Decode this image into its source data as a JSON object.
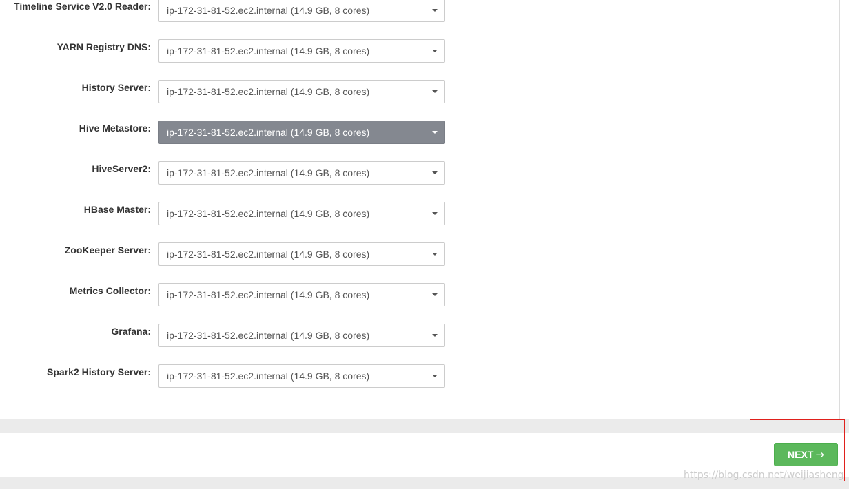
{
  "form": {
    "rows": [
      {
        "label": "Timeline Service V2.0 Reader:",
        "value": "ip-172-31-81-52.ec2.internal (14.9 GB, 8 cores)",
        "active": false
      },
      {
        "label": "YARN Registry DNS:",
        "value": "ip-172-31-81-52.ec2.internal (14.9 GB, 8 cores)",
        "active": false
      },
      {
        "label": "History Server:",
        "value": "ip-172-31-81-52.ec2.internal (14.9 GB, 8 cores)",
        "active": false
      },
      {
        "label": "Hive Metastore:",
        "value": "ip-172-31-81-52.ec2.internal (14.9 GB, 8 cores)",
        "active": true
      },
      {
        "label": "HiveServer2:",
        "value": "ip-172-31-81-52.ec2.internal (14.9 GB, 8 cores)",
        "active": false
      },
      {
        "label": "HBase Master:",
        "value": "ip-172-31-81-52.ec2.internal (14.9 GB, 8 cores)",
        "active": false
      },
      {
        "label": "ZooKeeper Server:",
        "value": "ip-172-31-81-52.ec2.internal (14.9 GB, 8 cores)",
        "active": false
      },
      {
        "label": "Metrics Collector:",
        "value": "ip-172-31-81-52.ec2.internal (14.9 GB, 8 cores)",
        "active": false
      },
      {
        "label": "Grafana:",
        "value": "ip-172-31-81-52.ec2.internal (14.9 GB, 8 cores)",
        "active": false
      },
      {
        "label": "Spark2 History Server:",
        "value": "ip-172-31-81-52.ec2.internal (14.9 GB, 8 cores)",
        "active": false
      }
    ]
  },
  "footer": {
    "next_label": "NEXT",
    "next_arrow": "→"
  },
  "watermark": "https://blog.csdn.net/weijiasheng",
  "colors": {
    "active_select": "#848890",
    "next_button": "#5cb85c",
    "highlight": "#e0201c"
  }
}
